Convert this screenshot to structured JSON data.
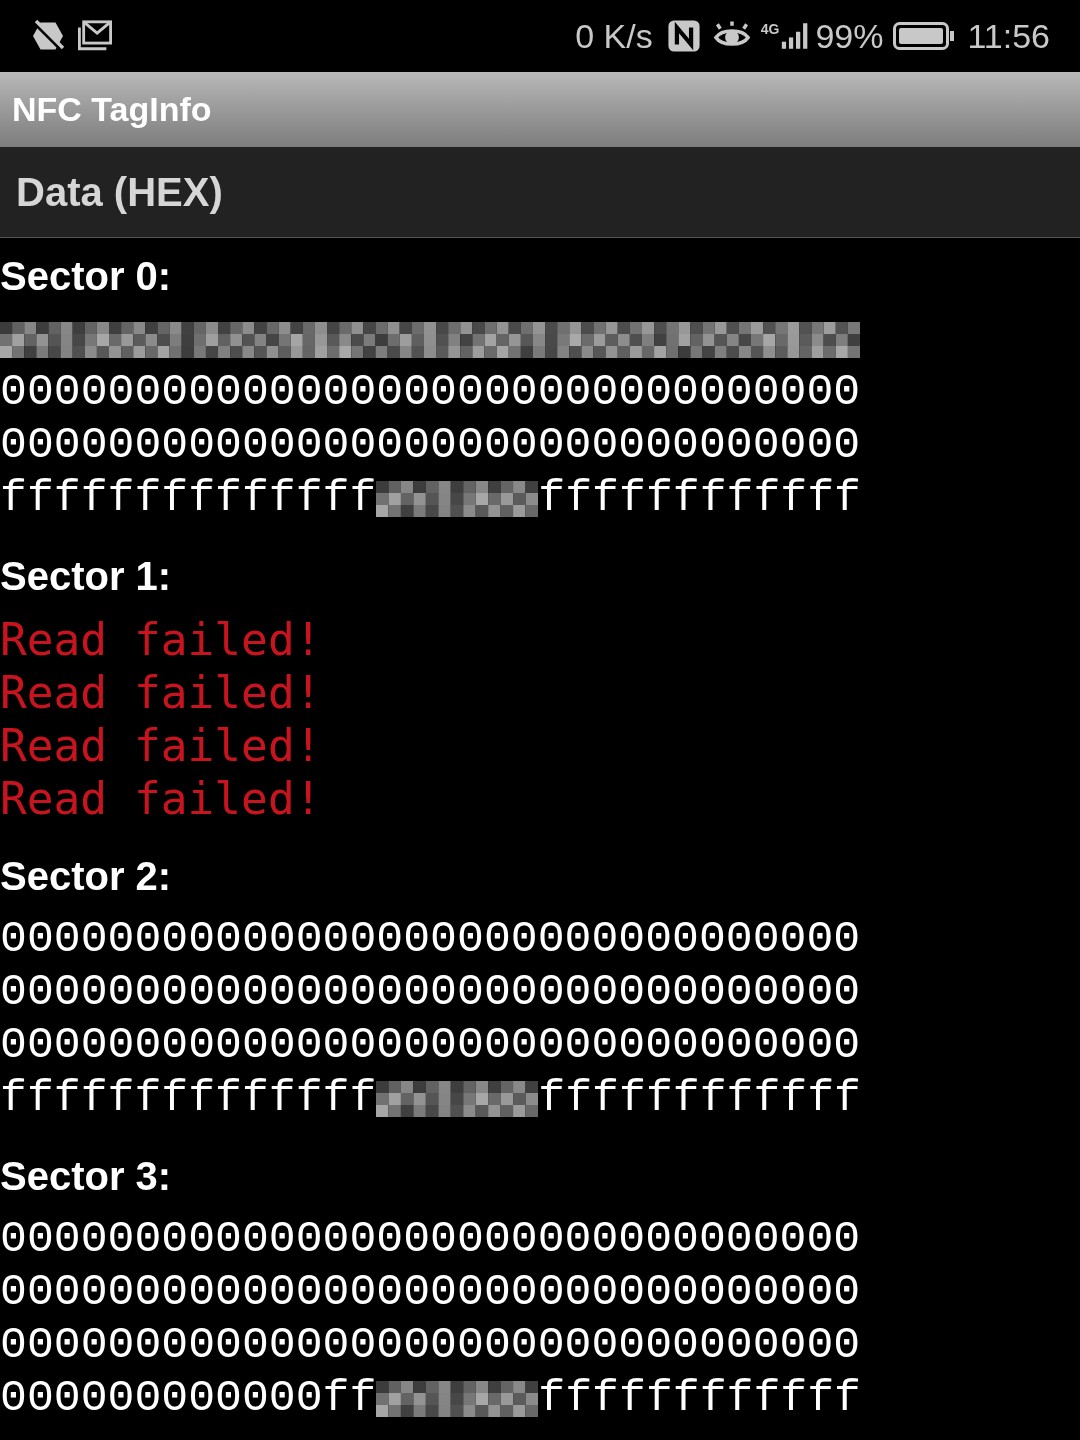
{
  "status_bar": {
    "speed": "0 K/s",
    "network": "4G",
    "battery": "99%",
    "time": "11:56"
  },
  "app_bar": {
    "title": "NFC TagInfo"
  },
  "subheader": {
    "title": "Data (HEX)"
  },
  "sectors": [
    {
      "title": "Sector 0:",
      "lines": [
        {
          "kind": "hex",
          "parts": [
            {
              "kind": "redacted_full"
            }
          ]
        },
        {
          "kind": "hex",
          "parts": [
            {
              "kind": "text",
              "text": "00000000000000000000000000000000"
            }
          ]
        },
        {
          "kind": "hex",
          "parts": [
            {
              "kind": "text",
              "text": "00000000000000000000000000000000"
            }
          ]
        },
        {
          "kind": "hex",
          "parts": [
            {
              "kind": "text",
              "text": "ffffffffffffff"
            },
            {
              "kind": "redacted"
            },
            {
              "kind": "text",
              "text": "ffffffffffff"
            }
          ]
        }
      ]
    },
    {
      "title": "Sector 1:",
      "lines": [
        {
          "kind": "error",
          "text": "Read failed!"
        },
        {
          "kind": "error",
          "text": "Read failed!"
        },
        {
          "kind": "error",
          "text": "Read failed!"
        },
        {
          "kind": "error",
          "text": "Read failed!"
        }
      ]
    },
    {
      "title": "Sector 2:",
      "lines": [
        {
          "kind": "hex",
          "parts": [
            {
              "kind": "text",
              "text": "00000000000000000000000000000000"
            }
          ]
        },
        {
          "kind": "hex",
          "parts": [
            {
              "kind": "text",
              "text": "00000000000000000000000000000000"
            }
          ]
        },
        {
          "kind": "hex",
          "parts": [
            {
              "kind": "text",
              "text": "00000000000000000000000000000000"
            }
          ]
        },
        {
          "kind": "hex",
          "parts": [
            {
              "kind": "text",
              "text": "ffffffffffffff"
            },
            {
              "kind": "redacted"
            },
            {
              "kind": "text",
              "text": "ffffffffffff"
            }
          ]
        }
      ]
    },
    {
      "title": "Sector 3:",
      "lines": [
        {
          "kind": "hex",
          "parts": [
            {
              "kind": "text",
              "text": "00000000000000000000000000000000"
            }
          ]
        },
        {
          "kind": "hex",
          "parts": [
            {
              "kind": "text",
              "text": "00000000000000000000000000000000"
            }
          ]
        },
        {
          "kind": "hex",
          "parts": [
            {
              "kind": "text",
              "text": "00000000000000000000000000000000"
            }
          ]
        },
        {
          "kind": "hex",
          "parts": [
            {
              "kind": "text",
              "text": "000000000000ff"
            },
            {
              "kind": "redacted"
            },
            {
              "kind": "text",
              "text": "ffffffffffff"
            }
          ]
        }
      ]
    }
  ]
}
